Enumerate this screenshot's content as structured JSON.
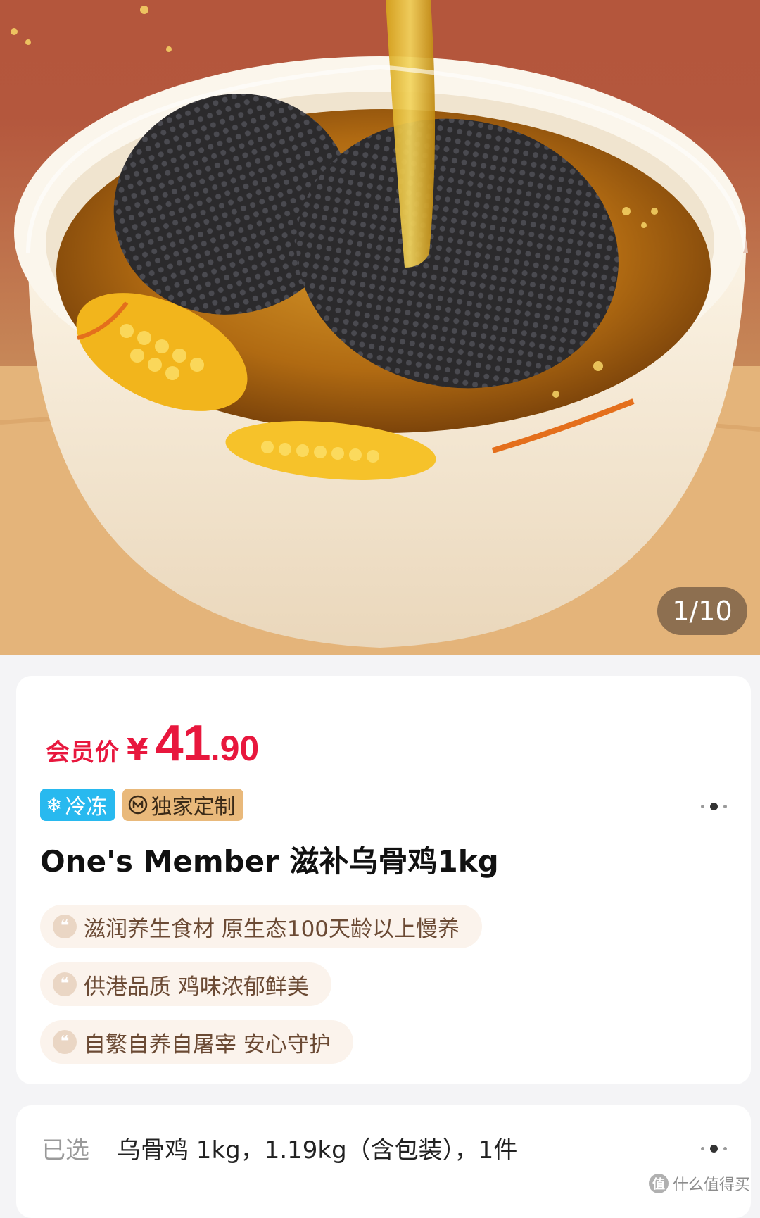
{
  "gallery": {
    "image_description_icon": "black-chicken-soup-photo",
    "counter": "1/10"
  },
  "product": {
    "price": {
      "label": "会员价",
      "currency": "¥",
      "integer": "41",
      "decimal": ".90",
      "color": "#e8173d"
    },
    "tags": [
      {
        "icon": "snowflake-icon",
        "label": "冷冻",
        "color": "#28b9ef"
      },
      {
        "icon": "brand-logo-icon",
        "label": "独家定制",
        "color": "#e9b97b"
      }
    ],
    "title": "One's Member 滋补乌骨鸡1kg",
    "features": [
      "滋润养生食材 原生态100天龄以上慢养",
      "供港品质 鸡味浓郁鲜美",
      "自繁自养自屠宰 安心守护"
    ]
  },
  "spec": {
    "label": "已选",
    "value": "乌骨鸡 1kg，1.19kg（含包装），1件"
  },
  "watermark": {
    "icon": "smzdm-logo-icon",
    "text": "什么值得买"
  }
}
